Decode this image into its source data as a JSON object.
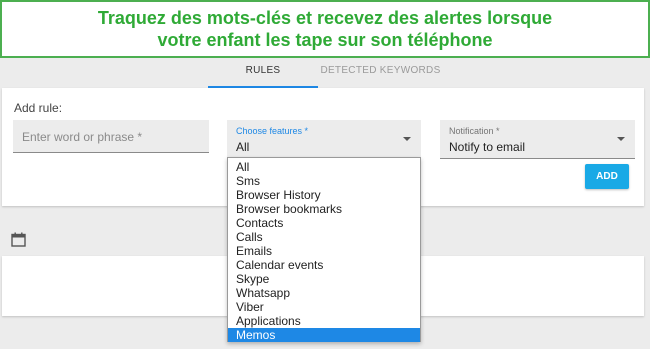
{
  "banner": {
    "line1": "Traquez des mots-clés et recevez des alertes lorsque",
    "line2": "votre enfant les tape sur son téléphone",
    "color": "#2faa36"
  },
  "tabs": [
    {
      "label": "RULES",
      "active": true
    },
    {
      "label": "DETECTED KEYWORDS",
      "active": false
    }
  ],
  "add_rule": {
    "title": "Add rule:",
    "word_placeholder": "Enter word or phrase *",
    "features_label": "Choose features *",
    "features_value": "All",
    "notification_label": "Notification *",
    "notification_value": "Notify to email",
    "add_button": "ADD"
  },
  "features_options": [
    "All",
    "Sms",
    "Browser History",
    "Browser bookmarks",
    "Contacts",
    "Calls",
    "Emails",
    "Calendar events",
    "Skype",
    "Whatsapp",
    "Viber",
    "Applications",
    "Memos"
  ],
  "selected_option": "Memos",
  "colors": {
    "accent": "#1e88e5",
    "button": "#19a9e6",
    "banner_border": "#4caf50"
  },
  "icons": {
    "calendar": "calendar-icon",
    "caret": "caret-down-icon"
  }
}
